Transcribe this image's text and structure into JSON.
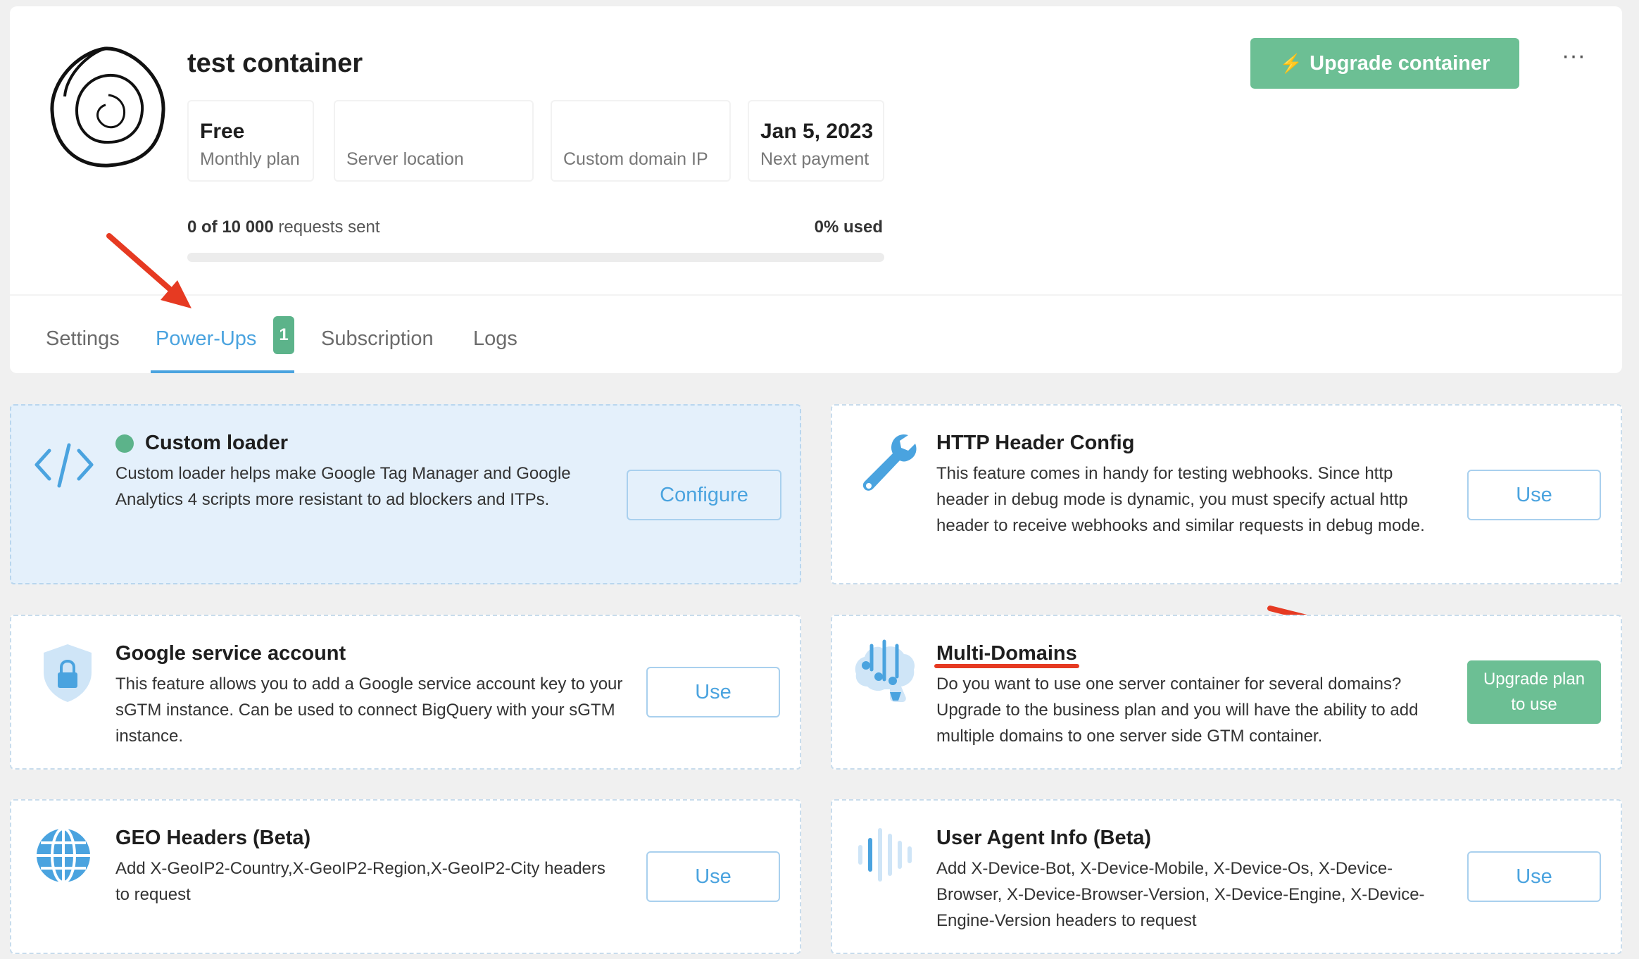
{
  "header": {
    "title": "test container",
    "upgrade_button": "Upgrade container",
    "more_label": "···",
    "info": [
      {
        "value": "Free",
        "label": "Monthly plan"
      },
      {
        "value": "",
        "label": "Server location"
      },
      {
        "value": "",
        "label": "Custom domain IP"
      },
      {
        "value": "Jan 5, 2023",
        "label": "Next payment"
      }
    ],
    "requests": {
      "count": "0 of 10 000",
      "suffix": " requests sent",
      "used": "0% used",
      "progress_fraction": 0
    }
  },
  "tabs": [
    {
      "label": "Settings"
    },
    {
      "label": "Power-Ups",
      "badge": "1",
      "active": true
    },
    {
      "label": "Subscription"
    },
    {
      "label": "Logs"
    }
  ],
  "powerups": [
    {
      "title": "Custom loader",
      "desc": "Custom loader helps make Google Tag Manager and Google Analytics 4 scripts more resistant to ad blockers and ITPs.",
      "button": "Configure",
      "icon": "code-icon",
      "active": true
    },
    {
      "title": "HTTP Header Config",
      "desc": "This feature comes in handy for testing webhooks. Since http header in debug mode is dynamic, you must specify actual http header to receive webhooks and similar requests in debug mode.",
      "button": "Use",
      "icon": "wrench-icon"
    },
    {
      "title": "Google service account",
      "desc": "This feature allows you to add a Google service account key to your sGTM instance. Can be used to connect BigQuery with your sGTM instance.",
      "button": "Use",
      "icon": "shield-lock-icon"
    },
    {
      "title": "Multi-Domains",
      "desc": "Do you want to use one server container for several domains? Upgrade to the business plan and you will have the ability to add multiple domains to one server side GTM container.",
      "button": "Upgrade plan to use",
      "icon": "brain-icon"
    },
    {
      "title": "GEO Headers (Beta)",
      "desc": "Add X-GeoIP2-Country,X-GeoIP2-Region,X-GeoIP2-City headers to request",
      "button": "Use",
      "icon": "globe-icon"
    },
    {
      "title": "User Agent Info (Beta)",
      "desc": "Add X-Device-Bot, X-Device-Mobile, X-Device-Os, X-Device-Browser, X-Device-Browser-Version, X-Device-Engine, X-Device-Engine-Version headers to request",
      "button": "Use",
      "icon": "bars-icon"
    }
  ],
  "colors": {
    "accent": "#4aa3df",
    "green": "#6cbf94",
    "annotation_red": "#e63a22"
  }
}
